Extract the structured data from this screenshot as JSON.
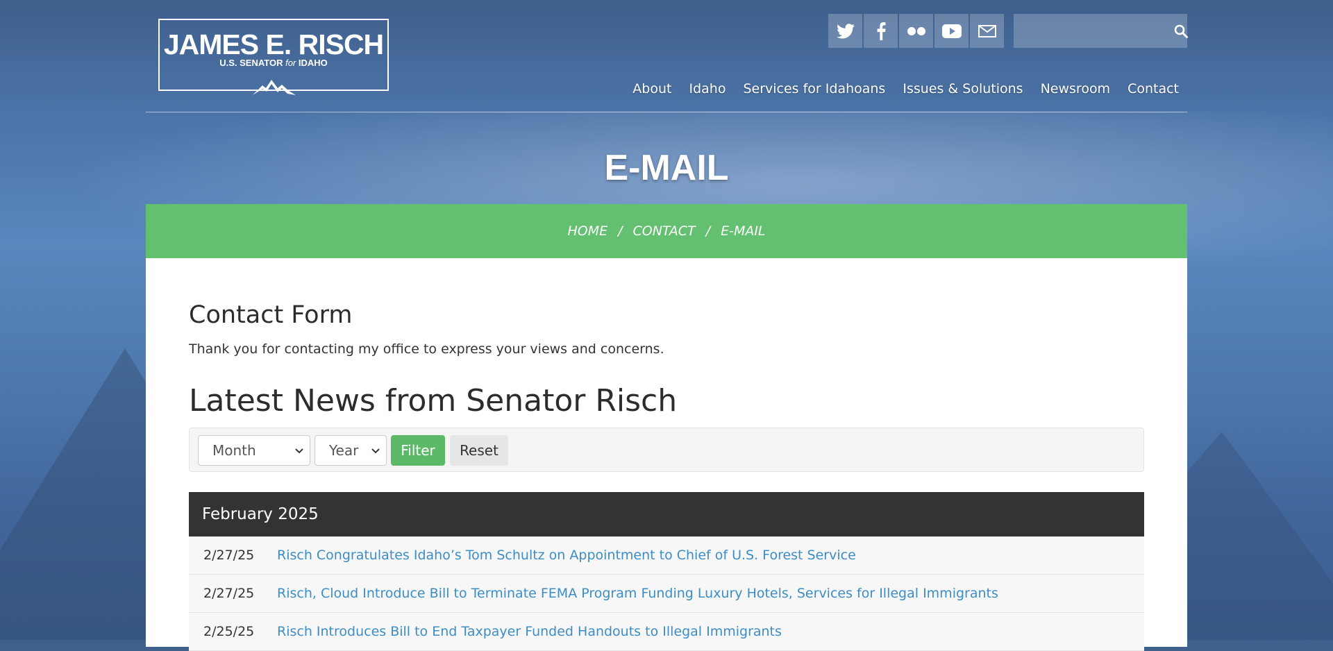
{
  "logo": {
    "name": "JAMES E. RISCH",
    "sub_pre": "U.S. SENATOR ",
    "sub_for": "for",
    "sub_post": " IDAHO"
  },
  "social": [
    "twitter-icon",
    "facebook-icon",
    "flickr-icon",
    "youtube-icon",
    "email-icon"
  ],
  "search": {
    "placeholder": ""
  },
  "nav": [
    "About",
    "Idaho",
    "Services for Idahoans",
    "Issues & Solutions",
    "Newsroom",
    "Contact"
  ],
  "page_title": "E-MAIL",
  "breadcrumb": [
    "HOME",
    "CONTACT",
    "E-MAIL"
  ],
  "breadcrumb_sep": "/",
  "content": {
    "contact_heading": "Contact Form",
    "thanks": "Thank you for contacting my office to express your views and concerns.",
    "news_heading": "Latest News from Senator Risch"
  },
  "filter": {
    "month": "Month",
    "year": "Year",
    "filter_label": "Filter",
    "reset_label": "Reset"
  },
  "news": {
    "month_label": "February 2025",
    "rows": [
      {
        "date": "2/27/25",
        "title": "Risch Congratulates Idaho’s Tom Schultz on Appointment to Chief of U.S. Forest Service"
      },
      {
        "date": "2/27/25",
        "title": "Risch, Cloud Introduce Bill to Terminate FEMA Program Funding Luxury Hotels, Services for Illegal Immigrants"
      },
      {
        "date": "2/25/25",
        "title": "Risch Introduces Bill to End Taxpayer Funded Handouts to Illegal Immigrants"
      }
    ]
  },
  "colors": {
    "accent_green": "#63c070",
    "link_blue": "#3c8dc7",
    "dark_header": "#333333"
  }
}
